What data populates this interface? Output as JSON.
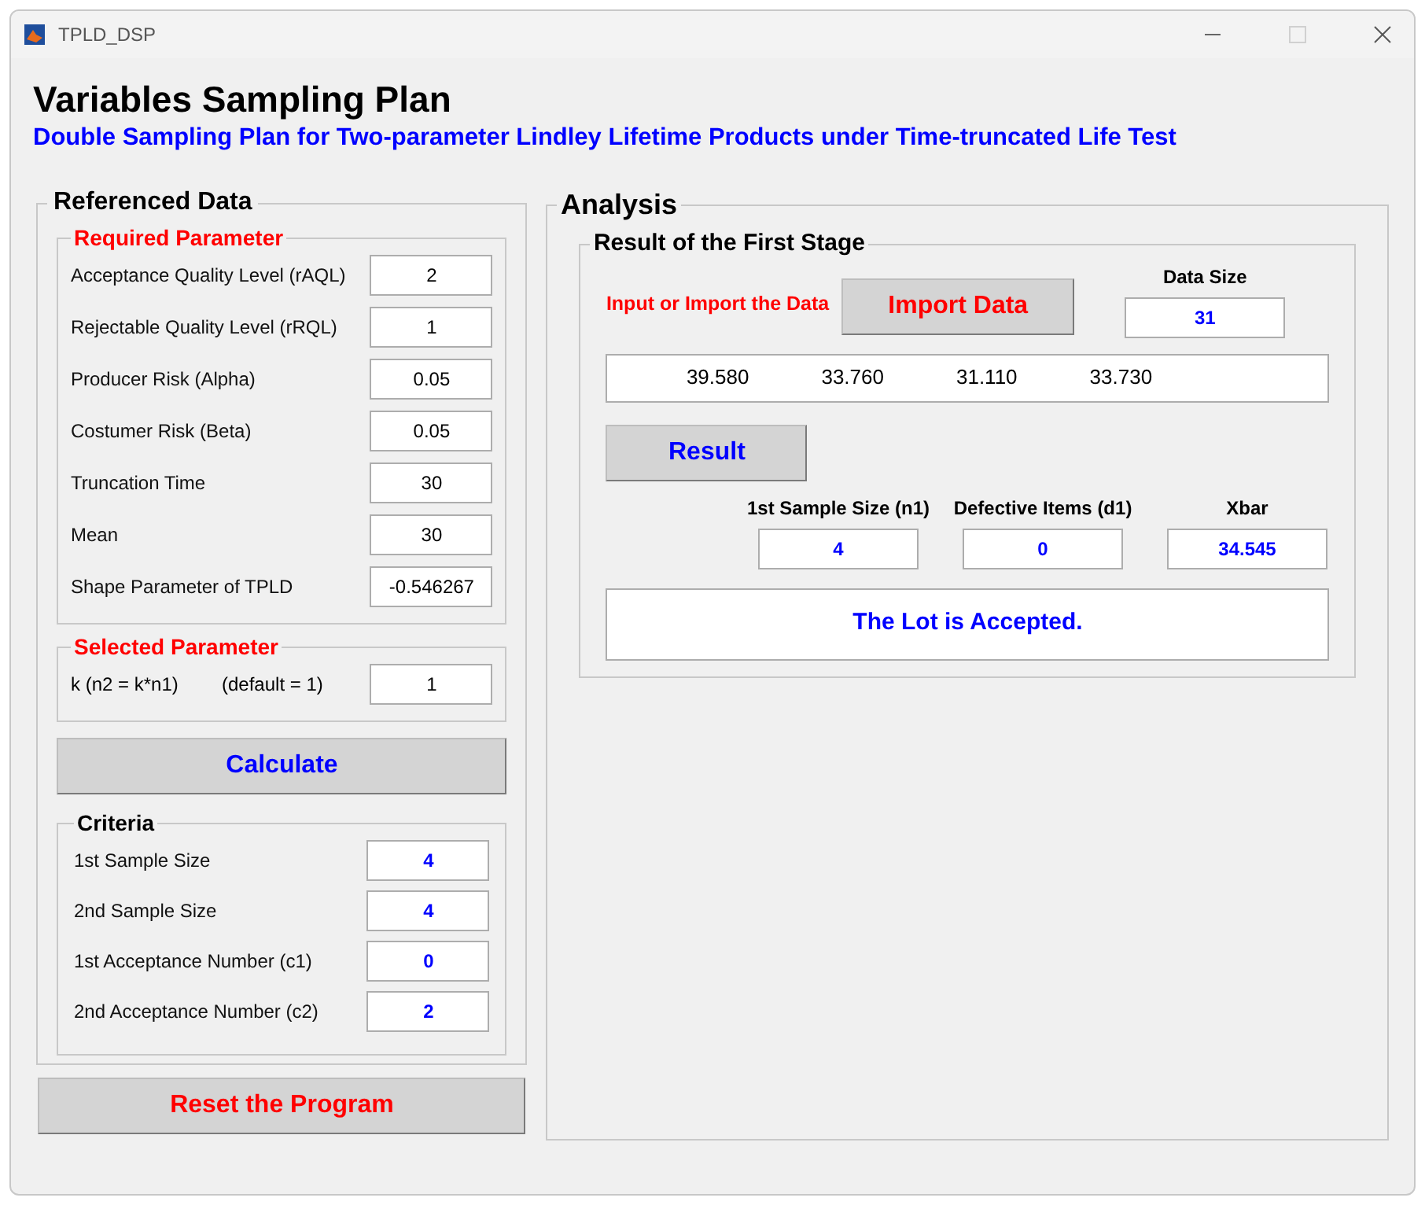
{
  "window": {
    "title": "TPLD_DSP"
  },
  "heading": "Variables Sampling Plan",
  "subtitle": "Double Sampling Plan for Two-parameter Lindley Lifetime Products under Time-truncated Life Test",
  "referenced_data": {
    "title": "Referenced Data",
    "required_parameter": {
      "title": "Required Parameter",
      "fields": [
        {
          "label": "Acceptance Quality Level (rAQL)",
          "value": "2"
        },
        {
          "label": "Rejectable Quality Level (rRQL)",
          "value": "1"
        },
        {
          "label": "Producer Risk (Alpha)",
          "value": "0.05"
        },
        {
          "label": "Costumer Risk (Beta)",
          "value": "0.05"
        },
        {
          "label": "Truncation Time",
          "value": "30"
        },
        {
          "label": "Mean",
          "value": "30"
        },
        {
          "label": "Shape Parameter of TPLD",
          "value": "-0.546267"
        }
      ]
    },
    "selected_parameter": {
      "title": "Selected Parameter",
      "label": "k (n2 = k*n1)",
      "hint": "(default = 1)",
      "value": "1"
    },
    "calculate_button": "Calculate",
    "criteria": {
      "title": "Criteria",
      "fields": [
        {
          "label": "1st Sample Size",
          "value": "4"
        },
        {
          "label": "2nd Sample Size",
          "value": "4"
        },
        {
          "label": "1st Acceptance Number (c1)",
          "value": "0"
        },
        {
          "label": "2nd Acceptance Number (c2)",
          "value": "2"
        }
      ]
    }
  },
  "reset_button": "Reset the Program",
  "analysis": {
    "title": "Analysis",
    "first_stage": {
      "title": "Result of the First Stage",
      "prompt": "Input or Import the Data",
      "import_button": "Import Data",
      "data_size": {
        "label": "Data Size",
        "value": "31"
      },
      "data_values": [
        "39.580",
        "33.760",
        "31.110",
        "33.730"
      ],
      "result_button": "Result",
      "outputs": [
        {
          "label": "1st Sample Size (n1)",
          "value": "4"
        },
        {
          "label": "Defective Items (d1)",
          "value": "0"
        },
        {
          "label": "Xbar",
          "value": "34.545"
        }
      ],
      "message": "The Lot is Accepted."
    }
  }
}
